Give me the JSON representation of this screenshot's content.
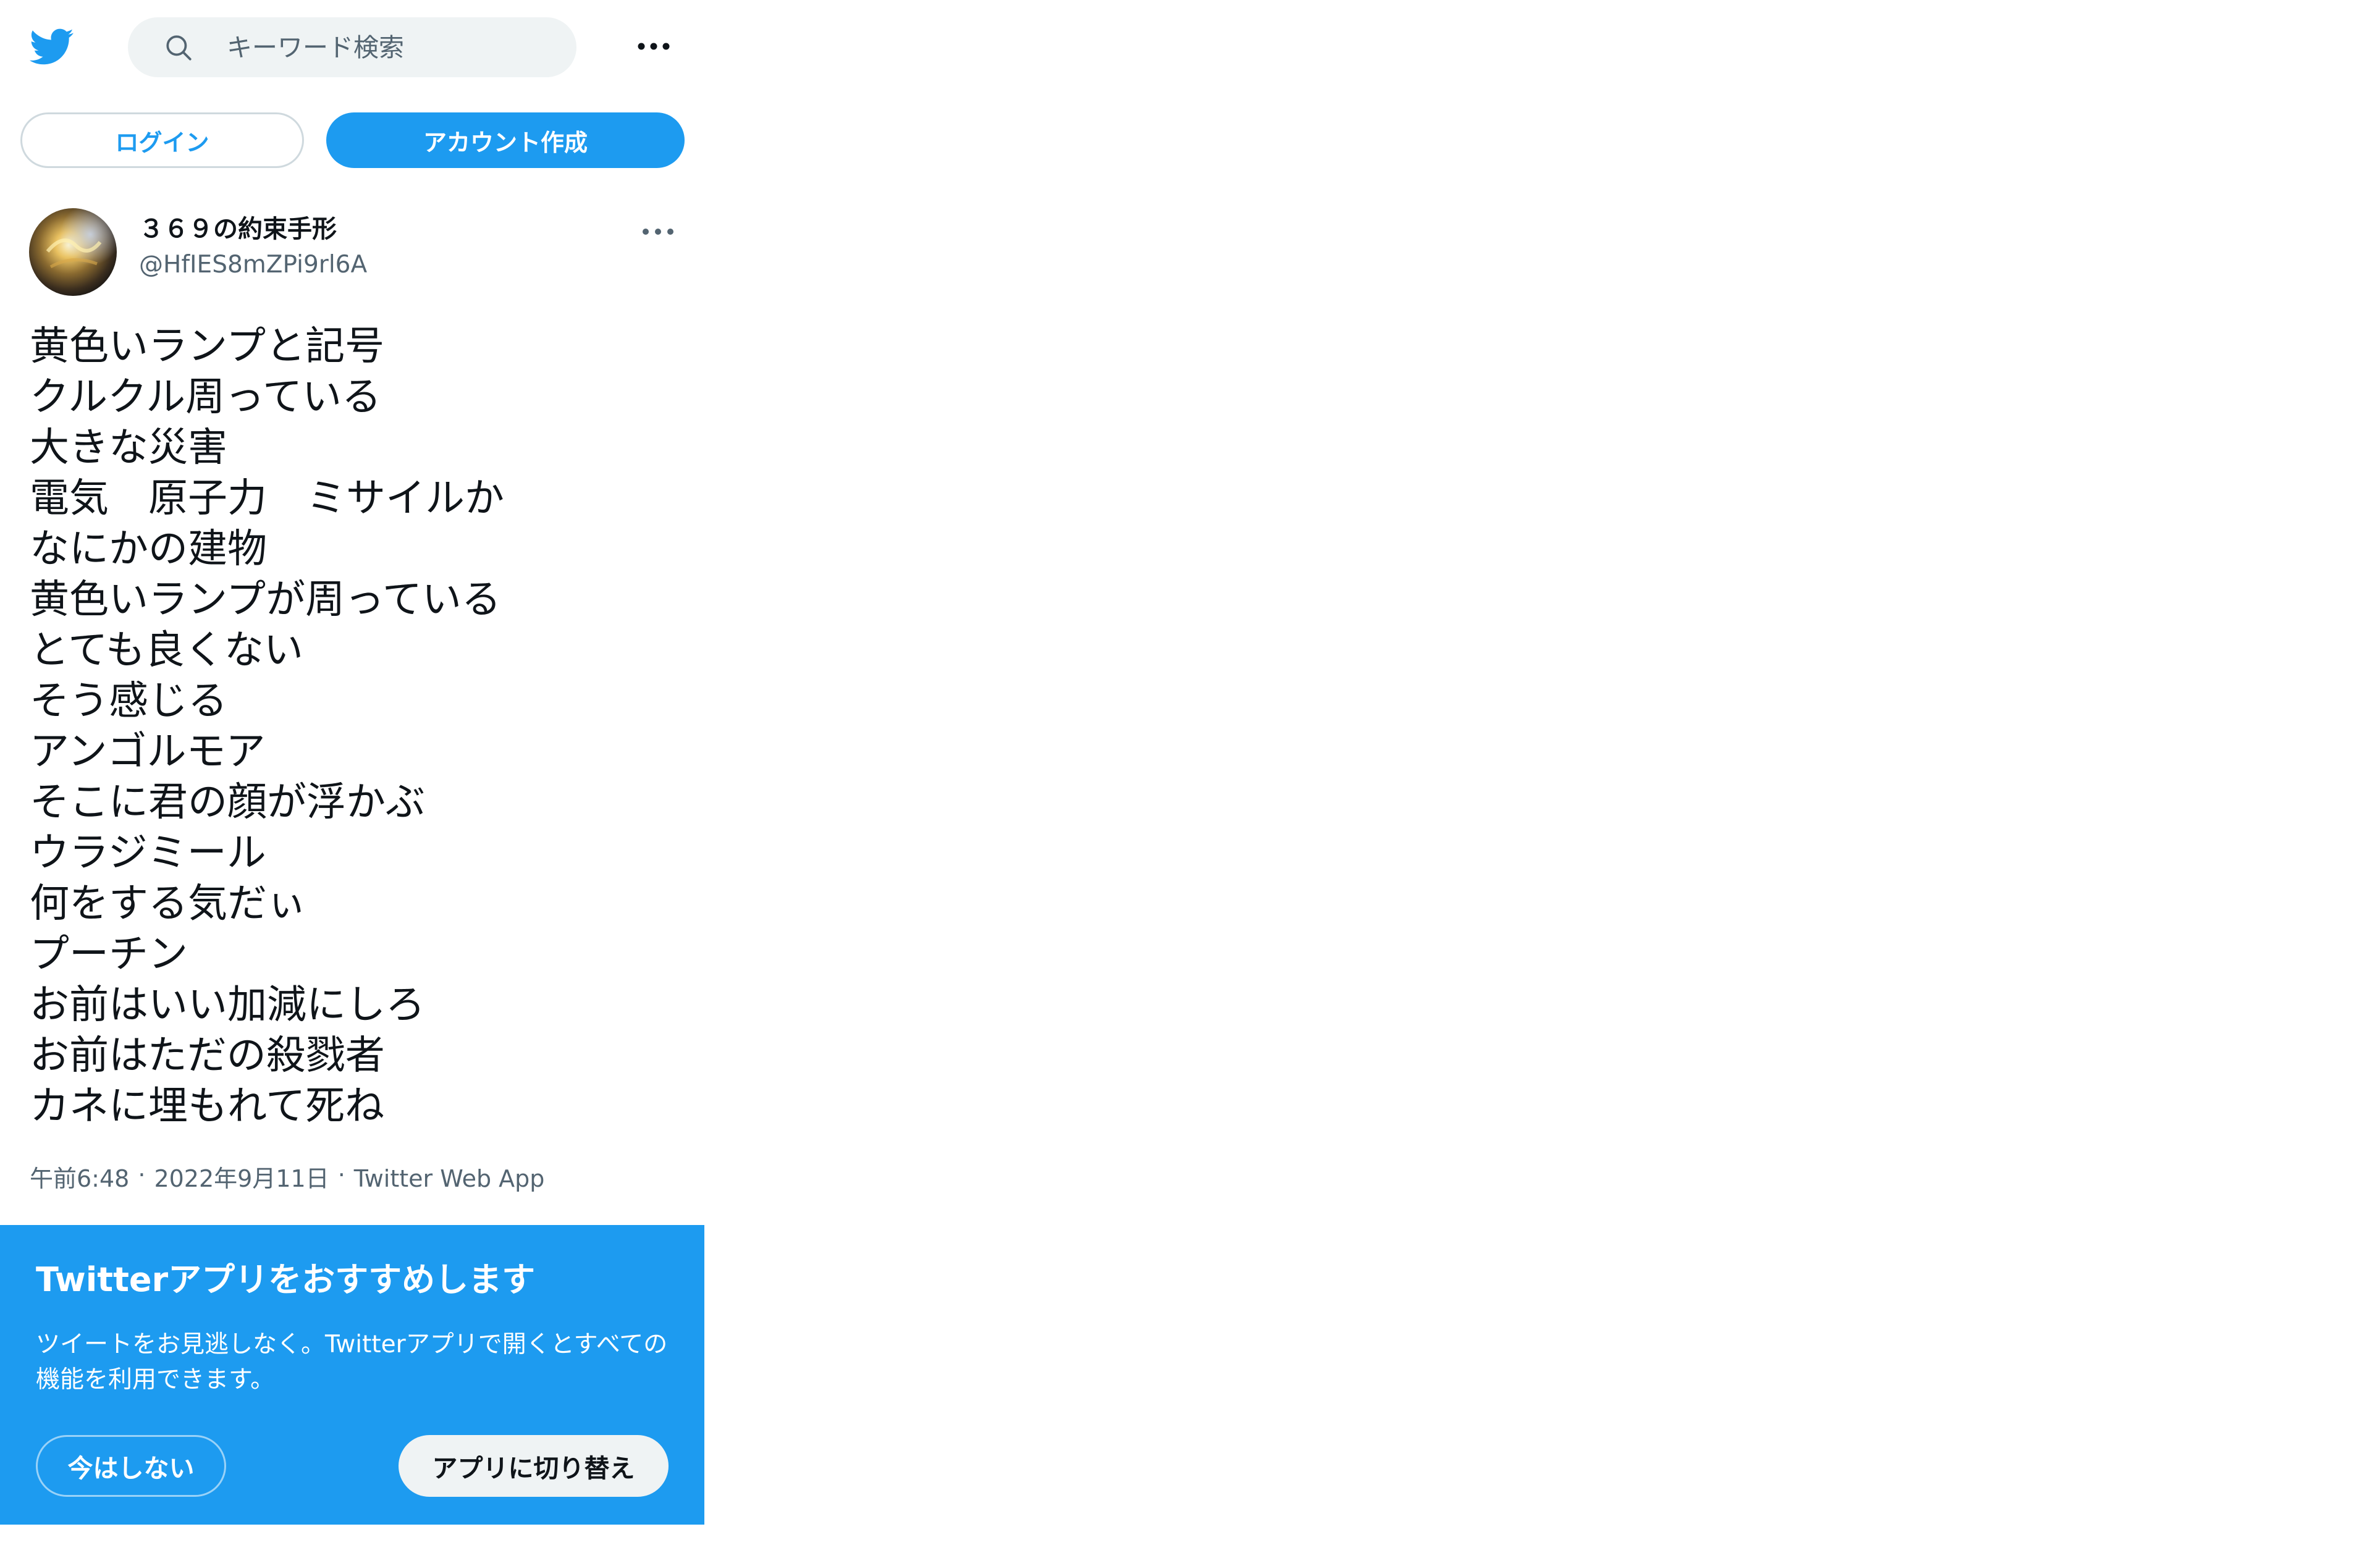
{
  "header": {
    "logo_icon": "twitter-bird-icon",
    "search_icon": "search-icon",
    "search_placeholder": "キーワード検索",
    "more_icon": "more-horizontal-icon"
  },
  "auth": {
    "login_label": "ログイン",
    "signup_label": "アカウント作成"
  },
  "tweet": {
    "display_name": "３６９の約束手形",
    "handle": "@HfIES8mZPi9rl6A",
    "more_icon": "more-horizontal-icon",
    "lines": [
      "黄色いランプと記号",
      "クルクル周っている",
      "大きな災害",
      "電気　原子力　ミサイルか",
      "なにかの建物",
      "黄色いランプが周っている",
      "とても良くない",
      "そう感じる",
      "アンゴルモア",
      "そこに君の顔が浮かぶ",
      "ウラジミール",
      "何をする気だぃ",
      "プーチン",
      "お前はいい加減にしろ",
      "お前はただの殺戮者",
      "カネに埋もれて死ね"
    ],
    "time": "午前6:48",
    "separator": "·",
    "date": "2022年9月11日",
    "source": "Twitter Web App"
  },
  "promo": {
    "title": "Twitterアプリをおすすめします",
    "description": "ツイートをお見逃しなく。Twitterアプリで開くとすべての機能を利用できます。",
    "not_now_label": "今はしない",
    "switch_label": "アプリに切り替え"
  },
  "colors": {
    "brand_blue": "#1d9bf0",
    "text_primary": "#0f1419",
    "text_secondary": "#536471",
    "search_bg": "#eff3f4"
  }
}
